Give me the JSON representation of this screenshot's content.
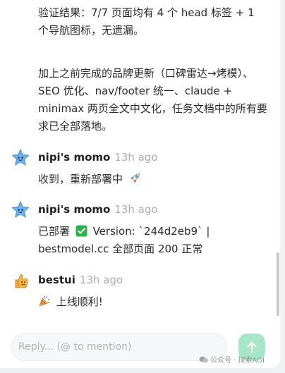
{
  "summary": {
    "line1": "验证结果：7/7 页面均有 4 个 head 标签 + 1 个导航图标，无遗漏。",
    "line2": "加上之前完成的品牌更新（口碑雷达→烤模）、SEO 优化、nav/footer 统一、claude + minimax 两页全文中文化，任务文档中的所有要求已全部落地。"
  },
  "messages": [
    {
      "author": "nipi's momo",
      "time": "13h ago",
      "avatar": "star-avatar",
      "text_before": "收到，重新部署中",
      "trailing_icon": "rocket-icon"
    },
    {
      "author": "nipi's momo",
      "time": "13h ago",
      "avatar": "star-avatar",
      "prefix": "已部署",
      "status_icon": "check-box-icon",
      "version_text": "Version: `244d2eb9` |",
      "line2": "bestmodel.cc 全部页面 200 正常"
    },
    {
      "author": "bestui",
      "time": "13h ago",
      "avatar": "thumbs-up-avatar",
      "leading_icon": "party-popper-icon",
      "text": "上线顺利!"
    }
  ],
  "composer": {
    "placeholder": "Reply... (@ to mention)",
    "value": ""
  },
  "watermark": {
    "text": "公众号 · 探索AGI"
  },
  "colors": {
    "send_button": "#a8e6c9",
    "timestamp": "#a9adb3",
    "check_green": "#2bb24c"
  }
}
